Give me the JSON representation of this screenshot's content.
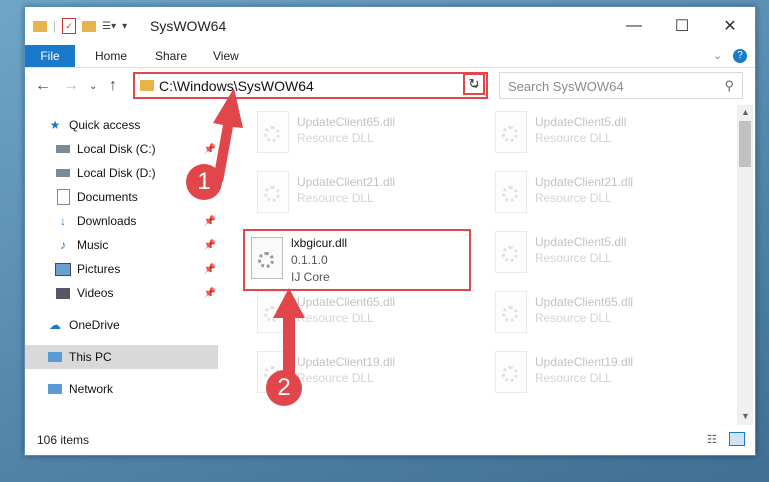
{
  "window": {
    "title": "SysWOW64"
  },
  "ribbon": {
    "tabs": [
      "File",
      "Home",
      "Share",
      "View"
    ]
  },
  "nav": {
    "address": "C:\\Windows\\SysWOW64",
    "search_placeholder": "Search SysWOW64"
  },
  "sidebar": {
    "items": [
      {
        "label": "Quick access"
      },
      {
        "label": "Local Disk (C:)"
      },
      {
        "label": "Local Disk (D:)"
      },
      {
        "label": "Documents"
      },
      {
        "label": "Downloads"
      },
      {
        "label": "Music"
      },
      {
        "label": "Pictures"
      },
      {
        "label": "Videos"
      },
      {
        "label": "OneDrive"
      },
      {
        "label": "This PC"
      },
      {
        "label": "Network"
      }
    ]
  },
  "files": [
    {
      "name": "UpdateClient65.dll",
      "desc": "Resource DLL"
    },
    {
      "name": "UpdateClient5.dll",
      "desc": "Resource DLL"
    },
    {
      "name": "UpdateClient21.dll",
      "desc": "Resource DLL"
    },
    {
      "name": "UpdateClient21.dll",
      "desc": "Resource DLL"
    },
    {
      "name": "UpdateClient5.dll",
      "desc": "Resource DLL"
    },
    {
      "name": "UpdateClient65.dll",
      "desc": "Resource DLL"
    },
    {
      "name": "UpdateClient65.dll",
      "desc": "Resource DLL"
    },
    {
      "name": "UpdateClient19.dll",
      "desc": "Resource DLL"
    },
    {
      "name": "UpdateClient19.dll",
      "desc": "Resource DLL"
    }
  ],
  "selected_file": {
    "name": "lxbgicur.dll",
    "version": "0.1.1.0",
    "company": "IJ Core"
  },
  "status": {
    "count": "106 items"
  },
  "annotations": [
    "1",
    "2"
  ],
  "colors": {
    "accent": "#1979ca",
    "highlight": "#e0464a"
  }
}
